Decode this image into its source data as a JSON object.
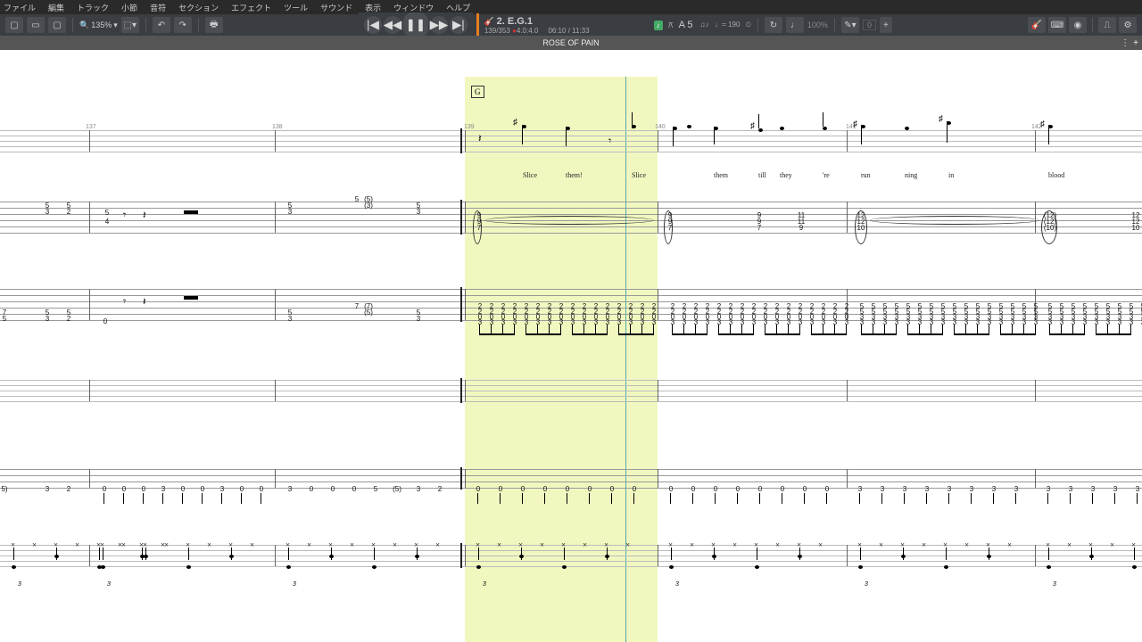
{
  "menu": {
    "items": [
      "ファイル",
      "編集",
      "トラック",
      "小節",
      "音符",
      "セクション",
      "エフェクト",
      "ツール",
      "サウンド",
      "表示",
      "ウィンドウ",
      "ヘルプ"
    ]
  },
  "toolbar": {
    "zoom": "135%",
    "undo_tip": "元に戻す",
    "redo_tip": "やり直し",
    "print_tip": "印刷"
  },
  "transport": {
    "track_no": "2.",
    "track_name": "E.G.1",
    "pitch": "A 5",
    "bar_pos": "139/353",
    "beat_pos": "4.0:4.0",
    "time_cur": "06:10",
    "time_total": "11:33",
    "tempo": "190",
    "speed_pct": "100%",
    "transpose": "0"
  },
  "title": "ROSE OF PAIN",
  "section_marker": "G",
  "bar_numbers": [
    "137",
    "138",
    "139",
    "140",
    "141",
    "142"
  ],
  "lyrics": [
    "Slice",
    "them!",
    "Slice",
    "them",
    "till",
    "they",
    "'re",
    "run",
    "ning",
    "in",
    "blood"
  ],
  "lyric_x": [
    586,
    634,
    708,
    800,
    850,
    874,
    922,
    965,
    1014,
    1063,
    1175
  ],
  "tab_track2_chords": {
    "m137a": [
      "5",
      "3"
    ],
    "m137b": [
      "5",
      "2"
    ],
    "m137ts": [
      "5",
      "4"
    ],
    "m138a": [
      "5",
      "3"
    ],
    "m138b": [
      "5",
      "(5)",
      "(3)"
    ],
    "m138c": [
      "5",
      "3"
    ],
    "m139": [
      "9",
      "9",
      "7"
    ],
    "m140a": [
      "9",
      "9",
      "7"
    ],
    "m140b": [
      "9",
      "9",
      "7"
    ],
    "m140c": [
      "11",
      "11",
      "9"
    ],
    "m141a": [
      "12",
      "12",
      "10"
    ],
    "m141b": [
      "(12)",
      "(12)",
      "(10)"
    ],
    "m142": [
      "12",
      "12",
      "10"
    ]
  },
  "tab_track3_m137": {
    "a": [
      "7",
      "5"
    ],
    "b": [
      "5",
      "3"
    ],
    "c": [
      "5",
      "2"
    ]
  },
  "tab_track3_m138": {
    "a": [
      "5",
      "3"
    ],
    "b": [
      "7",
      "(7)",
      "(5)"
    ],
    "c": [
      "5",
      "3"
    ]
  },
  "tab_track3_rhythm_pattern": [
    "2",
    "2",
    "0",
    "3"
  ],
  "tab_track3_rhythm_pattern2": [
    "5",
    "5",
    "3",
    "3"
  ],
  "tab_track5_pattern_m137": [
    "3",
    "2"
  ],
  "tab_track5_m138_seq": [
    "0",
    "0",
    "0",
    "3",
    "0",
    "0",
    "3",
    "0",
    "0"
  ],
  "tab_track5_m139_seq": [
    "3",
    "0",
    "0",
    "0",
    "5",
    "(5)",
    "3",
    "2"
  ],
  "tab_track5_zero": "0",
  "tab_track5_three": "3"
}
